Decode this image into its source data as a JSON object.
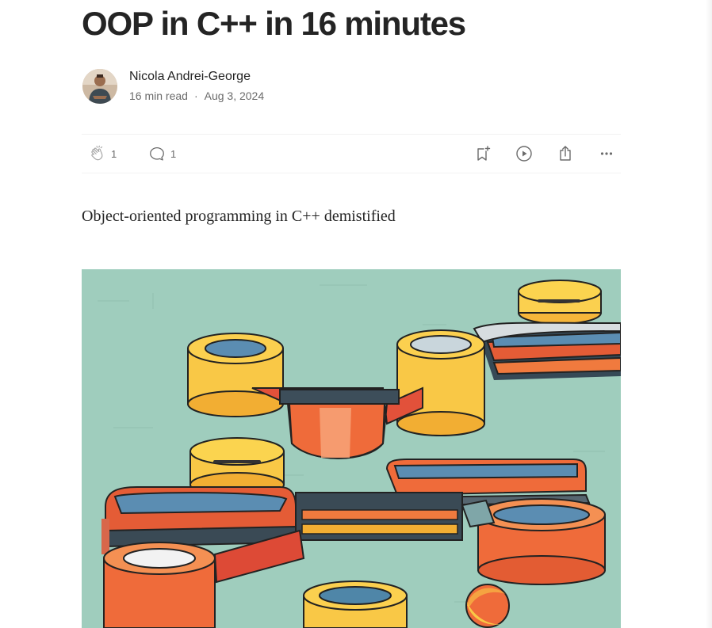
{
  "article": {
    "title": "OOP in C++ in 16 minutes",
    "subtitle": "Object-oriented programming in C++ demistified"
  },
  "author": {
    "name": "Nicola Andrei-George",
    "read_time": "16 min read",
    "separator": "·",
    "date": "Aug 3, 2024"
  },
  "actions": {
    "claps": "1",
    "responses": "1",
    "icons": [
      "clap-icon",
      "comment-icon",
      "bookmark-add-icon",
      "play-icon",
      "share-icon",
      "more-icon"
    ]
  },
  "colors": {
    "text": "#242424",
    "muted": "#6b6b6b",
    "hero_background": "#9fcdbd",
    "yellow": "#f9c846",
    "orange": "#ef6b3a",
    "red": "#dd4a36",
    "blue": "#4f86a8"
  }
}
